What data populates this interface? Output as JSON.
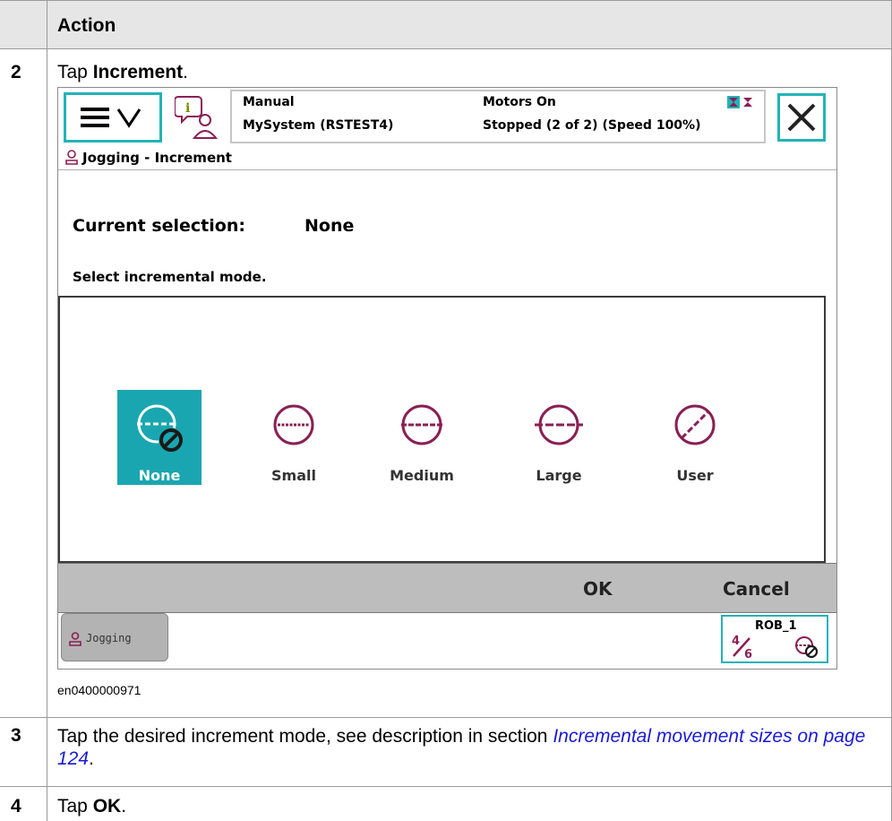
{
  "table": {
    "header": "Action",
    "steps": [
      {
        "num": "2",
        "text_plain": "Tap ",
        "text_bold": "Increment",
        "text_end": "."
      },
      {
        "num": "3",
        "text_plain": "Tap the desired increment mode, see description in section ",
        "link_line1": "Incremental movement",
        "link_line2": "sizes on page 124",
        "text_end": "."
      },
      {
        "num": "4",
        "text_plain": "Tap ",
        "text_bold": "OK",
        "text_end": "."
      }
    ]
  },
  "screen": {
    "status": {
      "mode": "Manual",
      "system": "MySystem (RSTEST4)",
      "motors": "Motors On",
      "state": "Stopped (2 of 2) (Speed 100%)"
    },
    "title": "Jogging - Increment",
    "current_selection_label": "Current selection:",
    "current_selection_value": "None",
    "instruction": "Select incremental mode.",
    "modes": [
      {
        "label": "None",
        "icon": "increment-none-icon",
        "selected": true
      },
      {
        "label": "Small",
        "icon": "increment-small-icon",
        "selected": false
      },
      {
        "label": "Medium",
        "icon": "increment-medium-icon",
        "selected": false
      },
      {
        "label": "Large",
        "icon": "increment-large-icon",
        "selected": false
      },
      {
        "label": "User",
        "icon": "increment-user-icon",
        "selected": false
      }
    ],
    "ok_label": "OK",
    "cancel_label": "Cancel",
    "jogging_tab": "Jogging",
    "robot_unit": "ROB_1",
    "accent_color": "#22b3b8",
    "brand_color": "#8a1f55"
  },
  "figure_id": "en0400000971"
}
